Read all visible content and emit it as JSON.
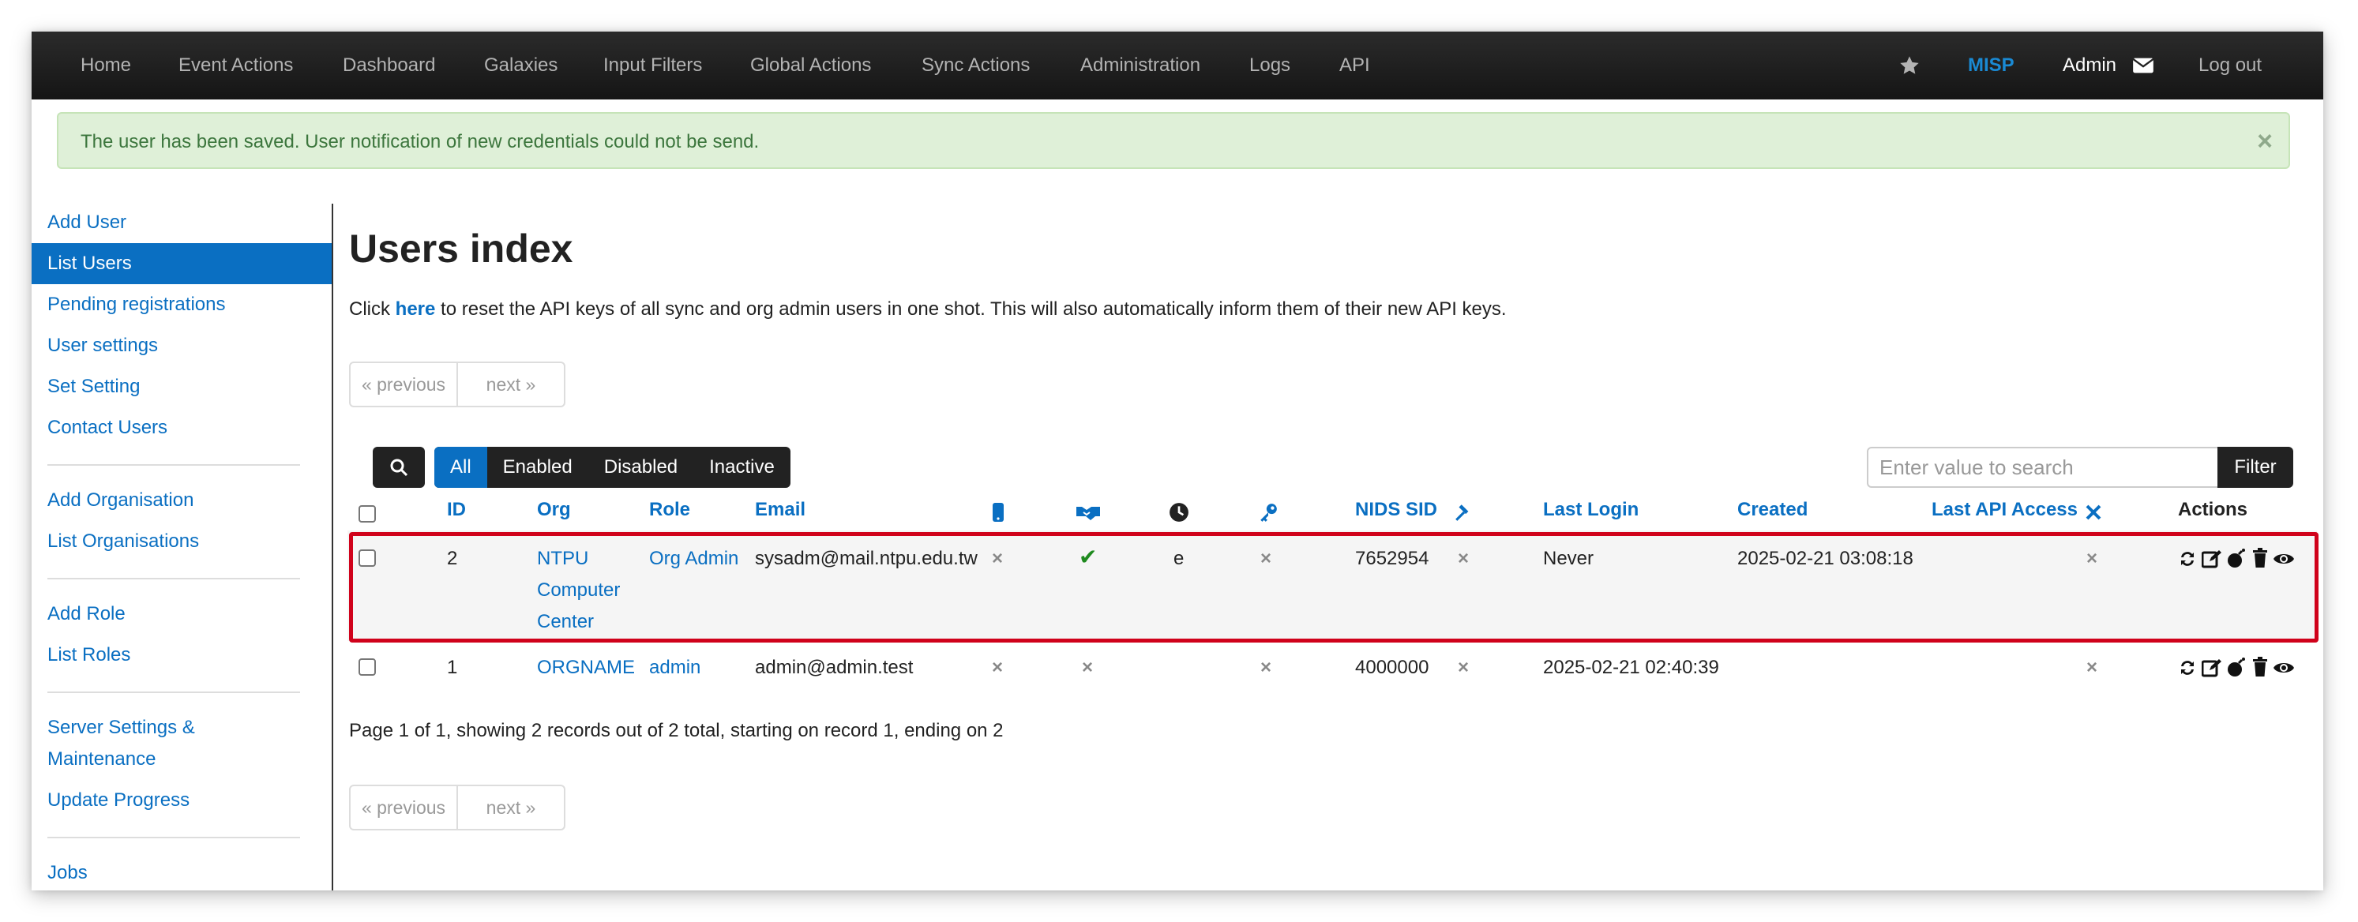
{
  "nav": {
    "items": [
      "Home",
      "Event Actions",
      "Dashboard",
      "Galaxies",
      "Input Filters",
      "Global Actions",
      "Sync Actions",
      "Administration",
      "Logs",
      "API"
    ],
    "brand": "MISP",
    "user": "Admin",
    "logout": "Log out"
  },
  "alert": {
    "message": "The user has been saved. User notification of new credentials could not be send.",
    "close": "×"
  },
  "sidebar": {
    "items": [
      "Add User",
      "List Users",
      "Pending registrations",
      "User settings",
      "Set Setting",
      "Contact Users",
      "Add Organisation",
      "List Organisations",
      "Add Role",
      "List Roles",
      "Server Settings &",
      "Maintenance",
      "Update Progress",
      "Jobs"
    ],
    "active": "List Users"
  },
  "main": {
    "title": "Users index",
    "info_prefix": "Click",
    "info_link": "here",
    "info_suffix": "to reset the API keys of all sync and org admin users in one shot. This will also automatically inform them of their new API keys.",
    "pager": {
      "previous": "« previous",
      "next": "next »"
    },
    "filters": [
      "All",
      "Enabled",
      "Disabled",
      "Inactive"
    ],
    "active_filter": "All",
    "search_placeholder": "Enter value to search",
    "filter_button": "Filter",
    "footer": "Page 1 of 1, showing 2 records out of 2 total, starting on record 1, ending on 2"
  },
  "table": {
    "headers": {
      "id": "ID",
      "org": "Org",
      "role": "Role",
      "email": "Email",
      "nids": "NIDS SID",
      "last_login": "Last Login",
      "created": "Created",
      "last_api": "Last API Access",
      "actions": "Actions"
    },
    "header_icons": [
      "mobile-icon",
      "handshake-icon",
      "clock-icon",
      "key-icon",
      "gavel-icon",
      "close-icon"
    ],
    "rows": [
      {
        "id": "2",
        "org_lines": [
          "NTPU",
          "Computer",
          "Center"
        ],
        "role": "Org Admin",
        "email": "sysadm@mail.ntpu.edu.tw",
        "mobile": "×",
        "terms": "✔",
        "contact": "e",
        "gpg": "×",
        "nids": "7652954",
        "disabled": "×",
        "last_login": "Never",
        "created": "2025-02-21 03:08:18",
        "last_api": "",
        "api_flag": "×"
      },
      {
        "id": "1",
        "org_lines": [
          "ORGNAME"
        ],
        "role": "admin",
        "email": "admin@admin.test",
        "mobile": "×",
        "terms": "×",
        "contact": "",
        "gpg": "×",
        "nids": "4000000",
        "disabled": "×",
        "last_login": "2025-02-21 02:40:39",
        "created": "",
        "last_api": "",
        "api_flag": "×"
      }
    ],
    "action_icons": [
      "refresh-icon",
      "edit-icon",
      "bomb-icon",
      "trash-icon",
      "eye-icon"
    ]
  }
}
